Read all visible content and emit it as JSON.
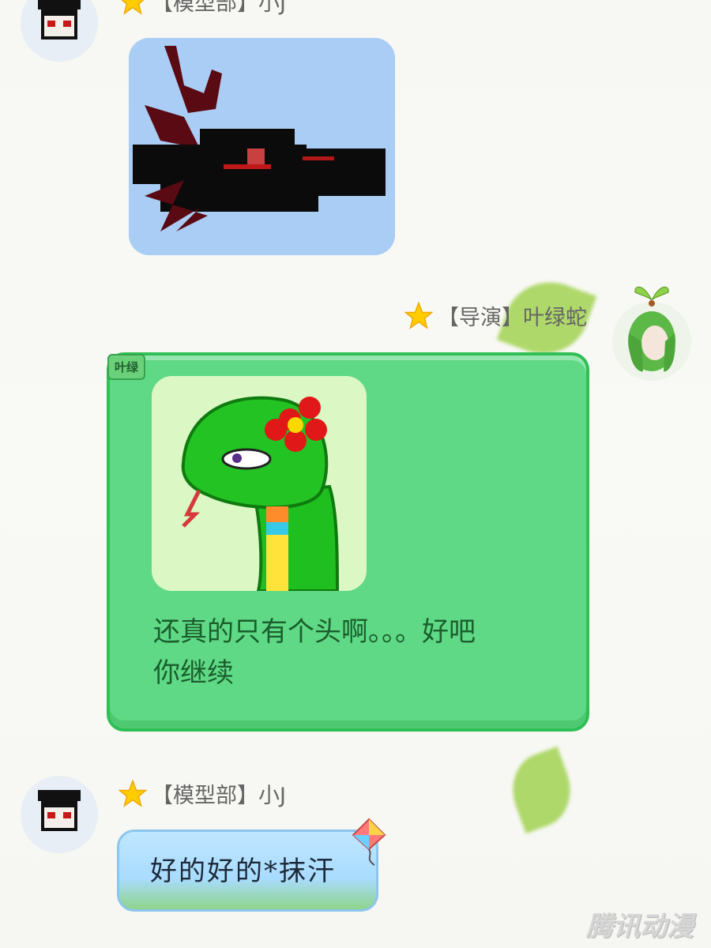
{
  "messages": [
    {
      "sender": {
        "star": "★",
        "name": "【模型部】小J"
      },
      "type": "image",
      "image_icon": "pixel-dragon-head-image"
    },
    {
      "sender": {
        "star": "★",
        "name": "【导演】叶绿蛇"
      },
      "tag": "叶绿",
      "image_icon": "snake-with-flower-image",
      "text": "还真的只有个头啊。。。好吧\n你继续"
    },
    {
      "sender": {
        "star": "★",
        "name": "【模型部】小J"
      },
      "text": "好的好的*抹汗"
    }
  ],
  "watermark": "腾讯动漫",
  "colors": {
    "green_bubble": "#5fd985",
    "green_border": "#2fbf55",
    "green_text": "#1a5e2c",
    "blue_bubble": "#bfe6ff",
    "star": "#ffcc00"
  }
}
